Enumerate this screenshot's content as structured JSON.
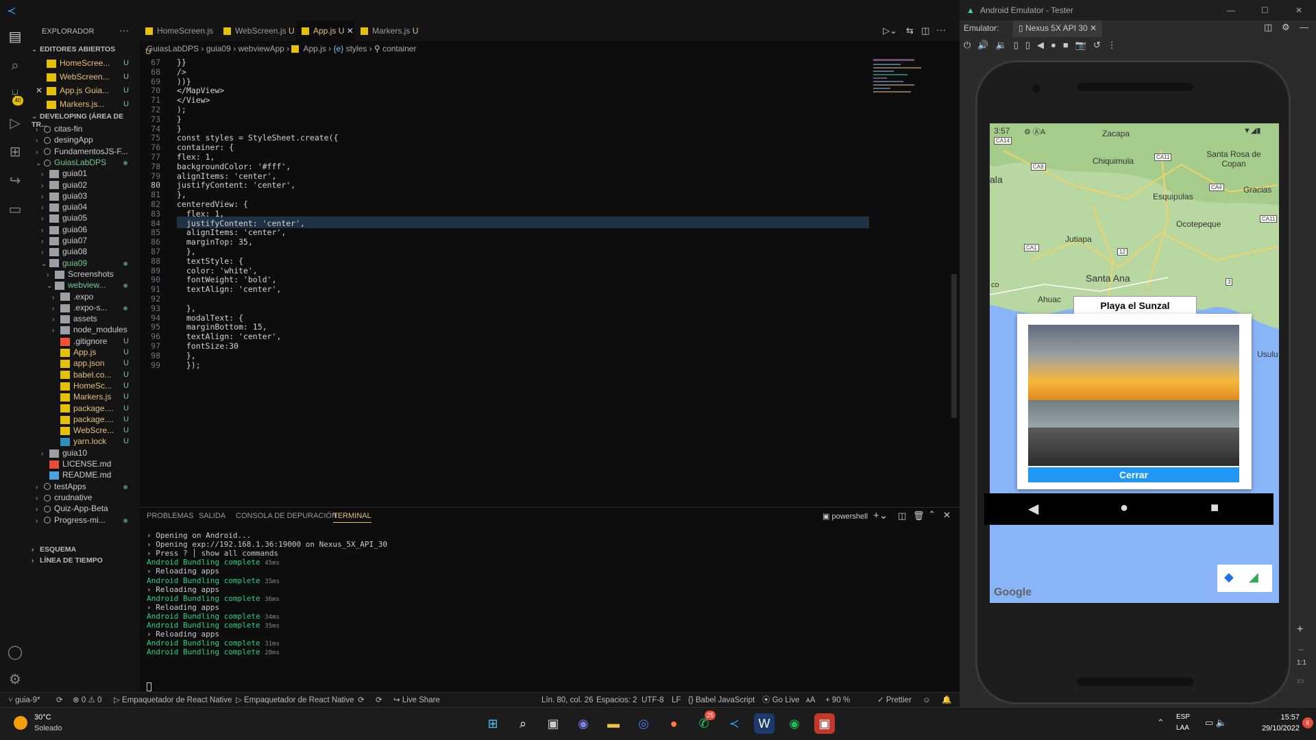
{
  "sidebar": {
    "title": "EXPLORADOR",
    "open_editors_title": "EDITORES ABIERTOS",
    "open_editors": [
      {
        "name": "HomeScree...",
        "badge": "U"
      },
      {
        "name": "WebScreen...",
        "badge": "U"
      },
      {
        "name": "App.js Guia...",
        "badge": "U"
      },
      {
        "name": "Markers.js...",
        "badge": "U"
      }
    ],
    "workspace_title": "DEVELOPING (ÁREA DE TR...",
    "tree": [
      {
        "name": "citas-fin"
      },
      {
        "name": "desingApp"
      },
      {
        "name": "FundamentosJS-F..."
      },
      {
        "name": "GuiasLabDPS"
      },
      {
        "name": "guia01"
      },
      {
        "name": "guia02"
      },
      {
        "name": "guia03"
      },
      {
        "name": "guia04"
      },
      {
        "name": "guia05"
      },
      {
        "name": "guia06"
      },
      {
        "name": "guia07"
      },
      {
        "name": "guia08"
      },
      {
        "name": "guia09"
      },
      {
        "name": "Screenshots"
      },
      {
        "name": "webview..."
      },
      {
        "name": ".expo"
      },
      {
        "name": ".expo-s..."
      },
      {
        "name": "assets"
      },
      {
        "name": "node_modules"
      },
      {
        "name": ".gitignore",
        "badge": "U"
      },
      {
        "name": "App.js",
        "badge": "U"
      },
      {
        "name": "app.json",
        "badge": "U"
      },
      {
        "name": "babel.co...",
        "badge": "U"
      },
      {
        "name": "HomeSc...",
        "badge": "U"
      },
      {
        "name": "Markers.js",
        "badge": "U"
      },
      {
        "name": "package....",
        "badge": "U"
      },
      {
        "name": "package....",
        "badge": "U"
      },
      {
        "name": "WebScre...",
        "badge": "U"
      },
      {
        "name": "yarn.lock",
        "badge": "U"
      },
      {
        "name": "guia10"
      },
      {
        "name": "LICENSE.md"
      },
      {
        "name": "README.md"
      },
      {
        "name": "testApps"
      },
      {
        "name": "crudnative"
      },
      {
        "name": "Quiz-App-Beta"
      },
      {
        "name": "Progress-mi..."
      }
    ],
    "outline": "ESQUEMA",
    "timeline": "LÍNEA DE TIEMPO",
    "scm_badge": "40"
  },
  "tabs": [
    {
      "label": "HomeScreen.js",
      "badge": "U"
    },
    {
      "label": "WebScreen.js",
      "badge": "U"
    },
    {
      "label": "App.js",
      "badge": "U"
    },
    {
      "label": "Markers.js",
      "badge": "U"
    }
  ],
  "breadcrumb": [
    "GuiasLabDPS",
    "guia09",
    "webviewApp",
    "App.js",
    "styles",
    "container"
  ],
  "code": {
    "line_numbers": [
      "67",
      "68",
      "69",
      "70",
      "71",
      "72",
      "73",
      "74",
      "75",
      "76",
      "77",
      "78",
      "79",
      "80",
      "81",
      "82",
      "83",
      "84",
      "85",
      "86",
      "87",
      "88",
      "89",
      "90",
      "91",
      "92",
      "93",
      "94",
      "95",
      "96",
      "97",
      "98",
      "99"
    ],
    "lines": [
      "}}",
      "/>",
      "))}",
      "</MapView>",
      "</View>",
      ");",
      "}",
      "}",
      "const styles = StyleSheet.create({",
      "container: {",
      "flex: 1,",
      "backgroundColor: '#fff',",
      "alignItems: 'center',",
      "justifyContent: 'center',",
      "},",
      "centeredView: {",
      "  flex: 1,",
      "  justifyContent: 'center',",
      "  alignItems: 'center',",
      "  marginTop: 35,",
      "  },",
      "  textStyle: {",
      "  color: 'white',",
      "  fontWeight: 'bold',",
      "  textAlign: 'center',",
      "",
      "  },",
      "  modalText: {",
      "  marginBottom: 15,",
      "  textAlign: 'center',",
      "  fontSize:30",
      "  },",
      "  });"
    ],
    "current_line": "80"
  },
  "panel": {
    "tabs": [
      "PROBLEMAS",
      "SALIDA",
      "CONSOLA DE DEPURACIÓN",
      "TERMINAL"
    ],
    "shell": "powershell",
    "terminal_lines": [
      {
        "prefix": "› ",
        "text": "Opening on Android..."
      },
      {
        "prefix": "› ",
        "text": "Opening exp://192.168.1.36:19000 on Nexus_5X_API_30"
      },
      {
        "prefix": "› ",
        "text": "Press ? │ show all commands"
      },
      {
        "android": "Android",
        "bundle": "Bundling complete",
        "ms": "45ms"
      },
      {
        "prefix": "› ",
        "text": "Reloading apps"
      },
      {
        "android": "Android",
        "bundle": "Bundling complete",
        "ms": "35ms"
      },
      {
        "prefix": "› ",
        "text": "Reloading apps"
      },
      {
        "android": "Android",
        "bundle": "Bundling complete",
        "ms": "36ms"
      },
      {
        "prefix": "› ",
        "text": "Reloading apps"
      },
      {
        "android": "Android",
        "bundle": "Bundling complete",
        "ms": "34ms"
      },
      {
        "android": "Android",
        "bundle": "Bundling complete",
        "ms": "35ms"
      },
      {
        "prefix": "› ",
        "text": "Reloading apps"
      },
      {
        "android": "Android",
        "bundle": "Bundling complete",
        "ms": "31ms"
      },
      {
        "android": "Android",
        "bundle": "Bundling complete",
        "ms": "28ms"
      }
    ]
  },
  "statusbar": {
    "branch": "guia-9*",
    "errors": "0",
    "warnings": "0",
    "packager1": "Empaquetador de React Native",
    "packager2": "Empaquetador de React Native",
    "live_share": "Live Share",
    "position": "Lín. 80, col. 26",
    "spaces": "Espacios: 2",
    "encoding": "UTF-8",
    "eol": "LF",
    "language": "Babel JavaScript",
    "golive": "Go Live",
    "zoom": "90 %",
    "prettier": "Prettier"
  },
  "emulator": {
    "title": "Android Emulator - Tester",
    "label": "Emulator:",
    "device_tab": "Nexus 5X API 30",
    "zoom_label": "1:1",
    "phone": {
      "time": "3:57",
      "map_labels": [
        "Zacapa",
        "Chiquimula",
        "Santa Rosa de Copan",
        "Esquipulas",
        "Gracias",
        "Ocotepeque",
        "Jutiapa",
        "Santa Ana",
        "Ahuac",
        "Usulu",
        "co",
        "ala"
      ],
      "road_labels": [
        "CA14",
        "CA11",
        "CA9",
        "CA4",
        "CA11",
        "CA1",
        "12",
        "3"
      ],
      "modal_title": "Playa el Sunzal",
      "close_button": "Cerrar",
      "google": "Google"
    }
  },
  "taskbar": {
    "temp": "30°C",
    "weather": "Soleado",
    "lang1": "ESP",
    "lang2": "LAA",
    "time": "15:57",
    "date": "29/10/2022",
    "whatsapp_badge": "25",
    "notif_badge": "6"
  }
}
